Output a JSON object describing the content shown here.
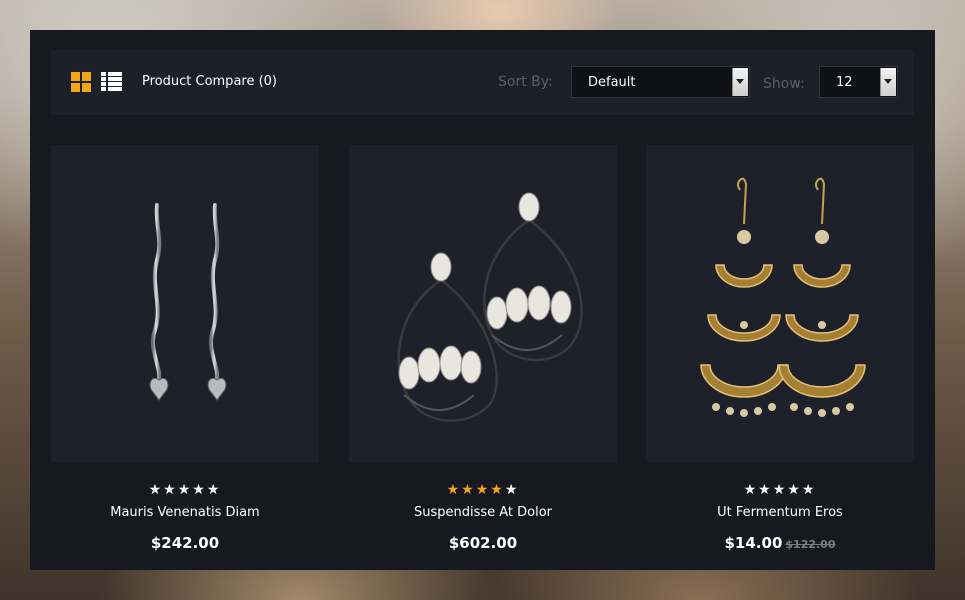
{
  "toolbar": {
    "view_grid_icon": "grid-view-icon",
    "view_list_icon": "list-view-icon",
    "compare_label": "Product Compare (0)",
    "sort_label": "Sort By:",
    "sort_value": "Default",
    "show_label": "Show:",
    "show_value": "12"
  },
  "colors": {
    "accent": "#f7a41d",
    "panel": "#161920",
    "card": "#1e2129"
  },
  "products": [
    {
      "name": "Mauris Venenatis Diam",
      "price": "$242.00",
      "old_price": "",
      "rating": 0,
      "stars": 5,
      "image": "silver-wave-drop-earrings"
    },
    {
      "name": "Suspendisse At Dolor",
      "price": "$602.00",
      "old_price": "",
      "rating": 4,
      "stars": 5,
      "image": "pearl-chandelier-earrings"
    },
    {
      "name": "Ut Fermentum Eros",
      "price": "$14.00",
      "old_price": "$122.00",
      "rating": 0,
      "stars": 5,
      "image": "gold-jhumka-earrings"
    }
  ]
}
